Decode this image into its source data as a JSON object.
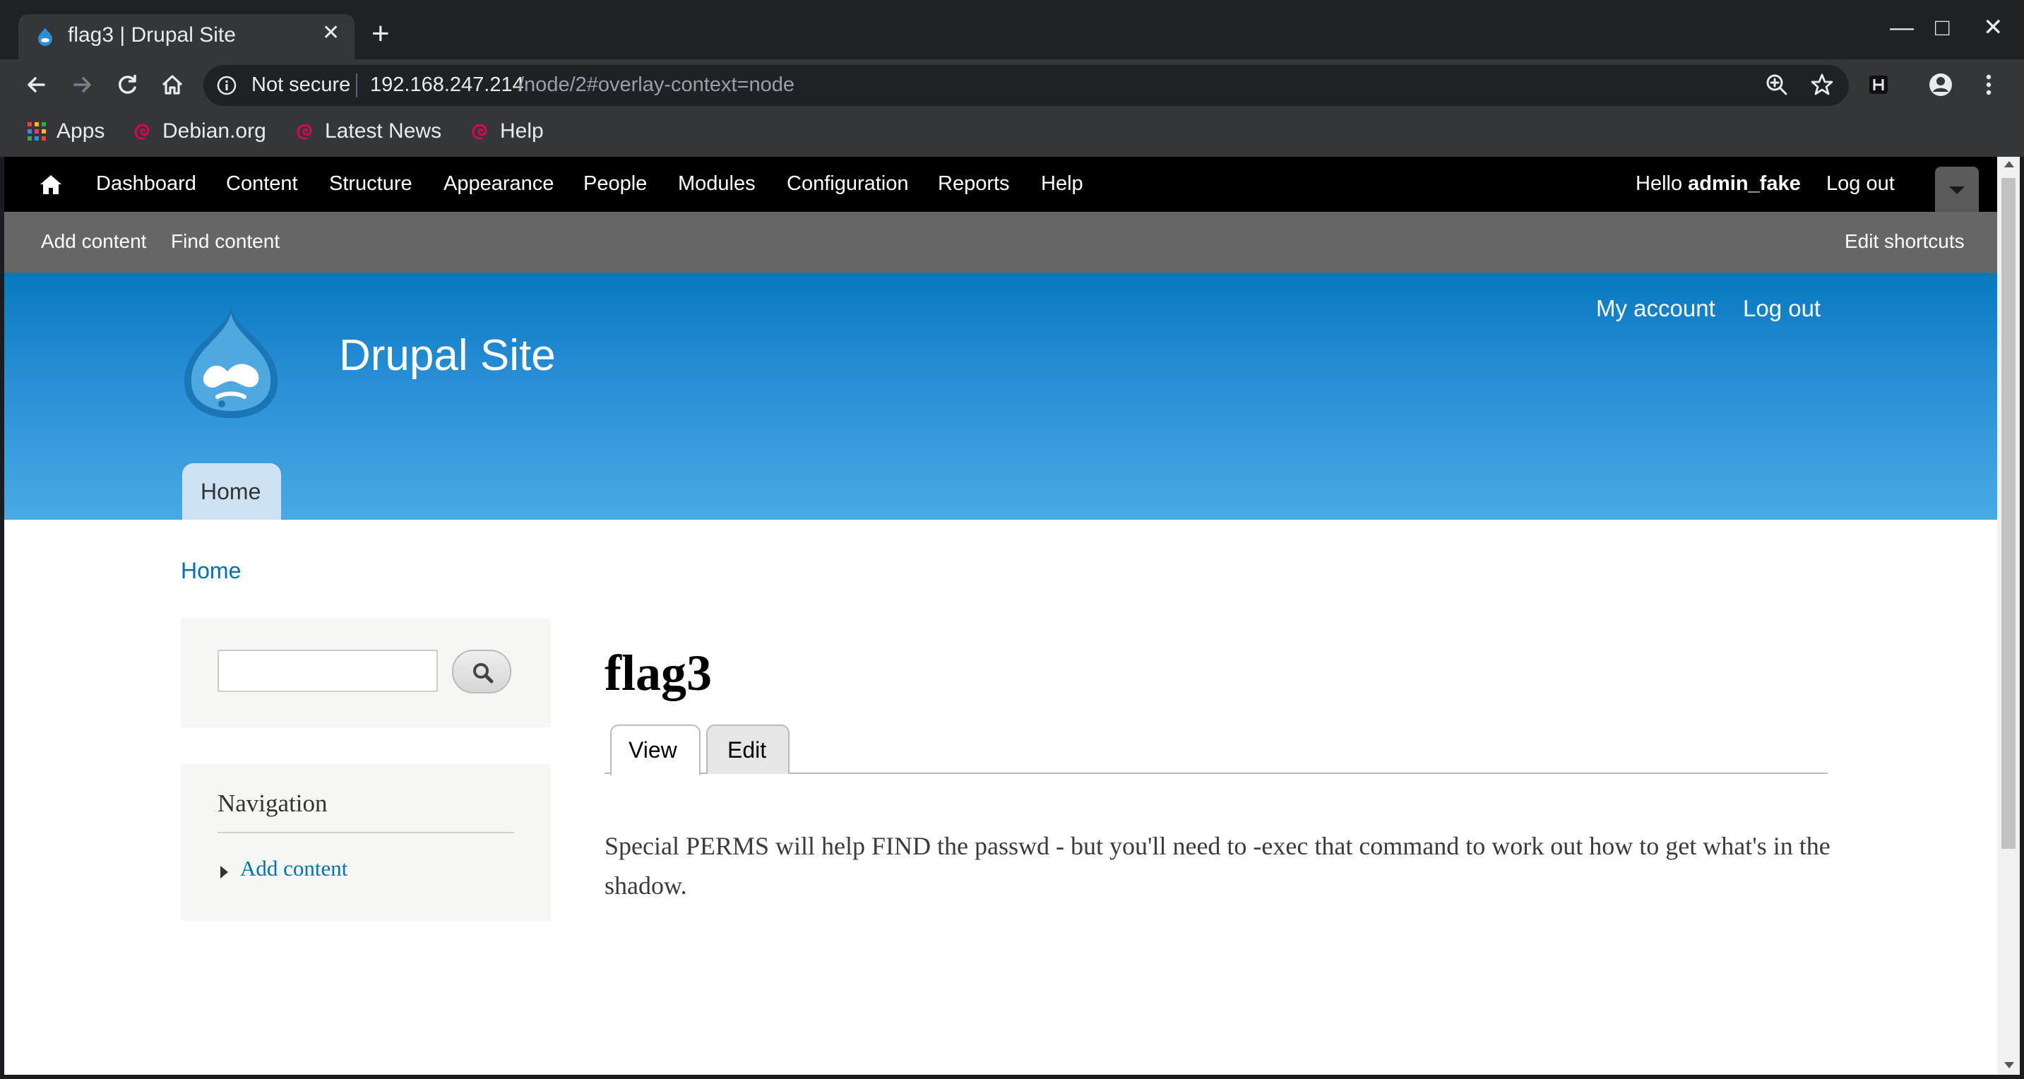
{
  "browser": {
    "tab_title": "flag3 | Drupal Site",
    "tab_close": "✕",
    "new_tab": "+",
    "window_controls": {
      "minimize": "—",
      "maximize": "□",
      "close": "✕"
    },
    "security_label": "Not secure",
    "url_host": "192.168.247.214",
    "url_path": "/node/2#overlay-context=node",
    "bookmarks": [
      "Apps",
      "Debian.org",
      "Latest News",
      "Help"
    ],
    "icons": [
      "back-icon",
      "forward-icon",
      "reload-icon",
      "home-icon",
      "info-icon",
      "zoom-icon",
      "star-icon",
      "extension-icon",
      "profile-icon",
      "menu-icon"
    ]
  },
  "admin_toolbar": {
    "items": [
      "Dashboard",
      "Content",
      "Structure",
      "Appearance",
      "People",
      "Modules",
      "Configuration",
      "Reports",
      "Help"
    ],
    "hello_prefix": "Hello ",
    "username": "admin_fake",
    "logout": "Log out"
  },
  "shortcuts": {
    "items": [
      "Add content",
      "Find content"
    ],
    "edit": "Edit shortcuts"
  },
  "header": {
    "site_name": "Drupal Site",
    "secondary_menu": [
      "My account",
      "Log out"
    ],
    "main_menu": [
      "Home"
    ]
  },
  "breadcrumb": "Home",
  "sidebar": {
    "navigation_title": "Navigation",
    "navigation_items": [
      "Add content"
    ]
  },
  "content": {
    "title": "flag3",
    "tabs": [
      "View",
      "Edit"
    ],
    "body": "Special PERMS will help FIND the passwd - but you'll need to -exec that command to work out how to get what's in the shadow."
  },
  "colors": {
    "link": "#0071b3",
    "header_top": "#0779bf",
    "header_bottom": "#48a9e4",
    "chrome_dark": "#202124",
    "chrome_toolbar": "#35363a"
  }
}
